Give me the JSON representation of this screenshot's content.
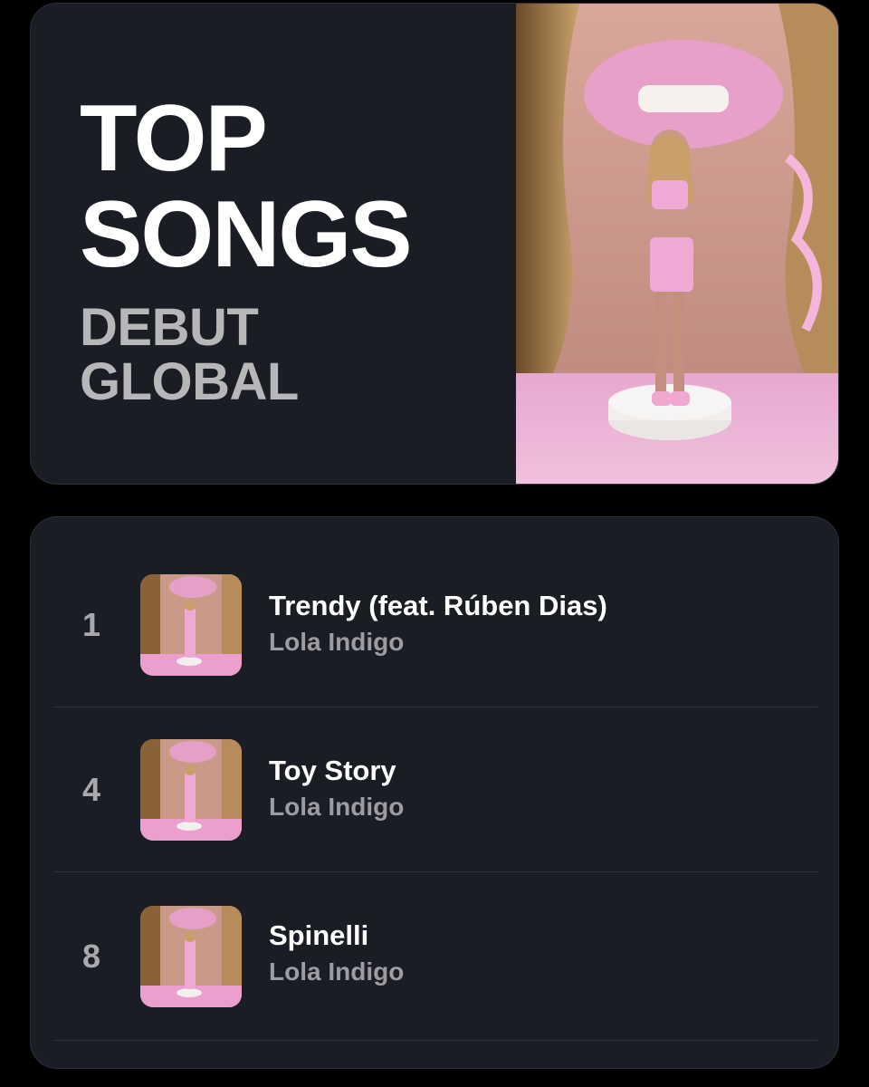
{
  "header": {
    "title_line1": "TOP",
    "title_line2": "SONGS",
    "subtitle_line1": "DEBUT",
    "subtitle_line2": "GLOBAL"
  },
  "songs": [
    {
      "rank": "1",
      "title": "Trendy (feat. Rúben Dias)",
      "artist": "Lola Indigo"
    },
    {
      "rank": "4",
      "title": "Toy Story",
      "artist": "Lola Indigo"
    },
    {
      "rank": "8",
      "title": "Spinelli",
      "artist": "Lola Indigo"
    }
  ],
  "colors": {
    "background": "#000000",
    "card": "#1b1d24",
    "title": "#ffffff",
    "subtitle": "#b7b7b9",
    "rank": "#a9a9ad",
    "artist": "#9c9ca1",
    "cover_pink": "#e9a9cf"
  }
}
